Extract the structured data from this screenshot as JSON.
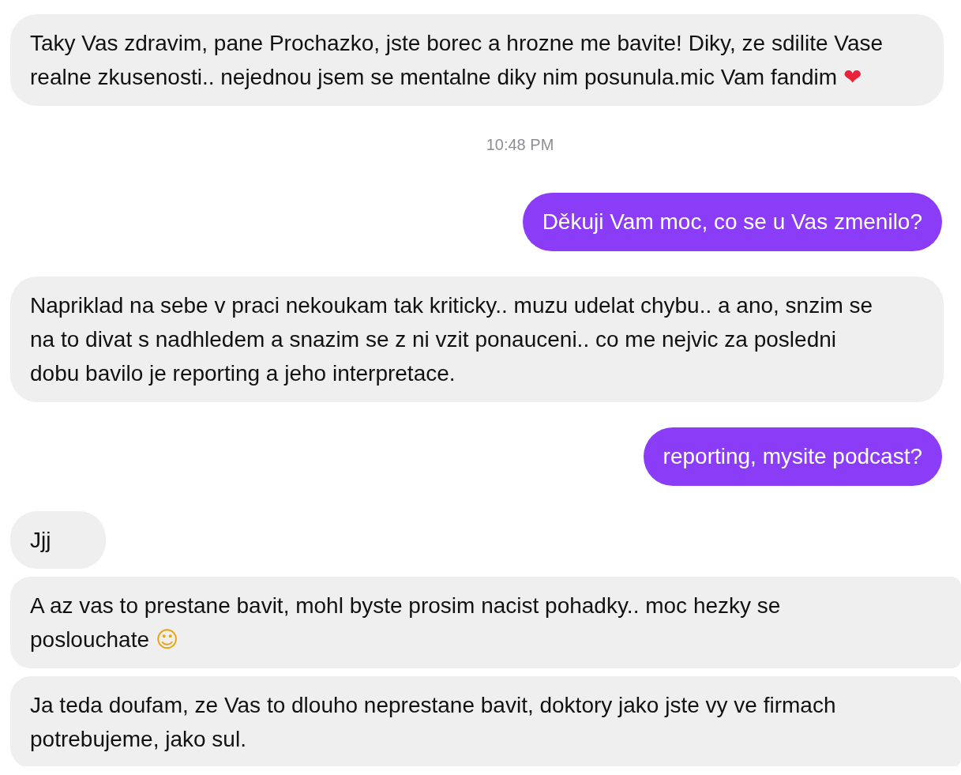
{
  "messages": [
    {
      "kind": "received",
      "text": "Taky Vas zdravim, pane Prochazko, jste borec a hrozne me bavite! Diky, ze sdilite Vase realne zkusenosti.. nejednou jsem se mentalne diky nim posunula.mic Vam fandim",
      "emoji": {
        "char": "❤",
        "color": "#e8243c"
      }
    },
    {
      "kind": "timestamp",
      "text": "10:48 PM"
    },
    {
      "kind": "sent",
      "text": "Děkuji Vam moc, co se u Vas zmenilo?"
    },
    {
      "kind": "received",
      "text": "Napriklad na sebe v praci nekoukam tak kriticky.. muzu udelat chybu.. a ano, snzim se na to divat s nadhledem a snazim se z ni vzit ponauceni.. co me nejvic za posledni dobu bavilo je reporting a jeho interpretace."
    },
    {
      "kind": "sent",
      "text": "reporting, mysite podcast?"
    },
    {
      "kind": "received",
      "text": "Jjj"
    },
    {
      "kind": "received",
      "wide": true,
      "text": "A az vas to prestane bavit, mohl byste prosim nacist pohadky.. moc hezky se poslouchate",
      "emoji": {
        "char": "☺",
        "color": "#e8a317"
      }
    },
    {
      "kind": "received",
      "wide": true,
      "text": "Ja teda doufam, ze Vas to dlouho neprestane bavit, doktory jako jste vy ve firmach potrebujeme, jako sul."
    }
  ]
}
